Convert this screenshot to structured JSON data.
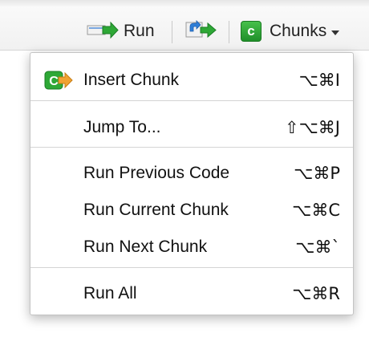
{
  "toolbar": {
    "run_label": "Run",
    "run_icon": "run-arrow-icon",
    "rerun_icon": "rerun-icon",
    "chunks_label": "Chunks",
    "chunks_icon": "c",
    "caret_icon": "chevron-down-icon"
  },
  "menu": {
    "items": [
      {
        "label": "Insert Chunk",
        "shortcut": "⌥⌘I",
        "icon": "insert-chunk-icon"
      },
      {
        "label": "Jump To...",
        "shortcut": "⇧⌥⌘J"
      },
      {
        "label": "Run Previous Code",
        "shortcut": "⌥⌘P"
      },
      {
        "label": "Run Current Chunk",
        "shortcut": "⌥⌘C"
      },
      {
        "label": "Run Next Chunk",
        "shortcut": "⌥⌘`"
      },
      {
        "label": "Run All",
        "shortcut": "⌥⌘R"
      }
    ]
  },
  "colors": {
    "accent_green": "#2ea836",
    "arrow_blue": "#2f7fd8",
    "icon_orange": "#f0a232"
  }
}
